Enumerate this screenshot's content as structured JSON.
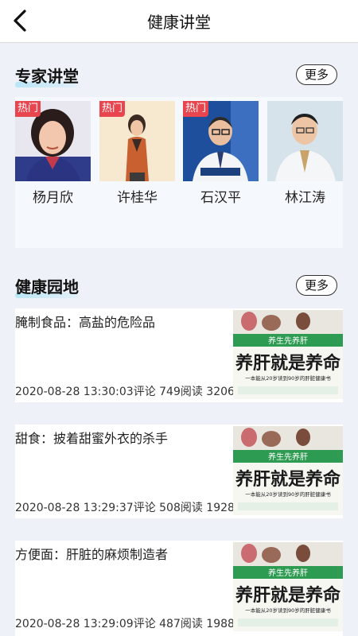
{
  "header": {
    "title": "健康讲堂",
    "back_icon": "chevron-left-icon"
  },
  "experts_section": {
    "title": "专家讲堂",
    "more_label": "更多",
    "experts": [
      {
        "name": "杨月欣",
        "tag": "热门"
      },
      {
        "name": "许桂华",
        "tag": "热门"
      },
      {
        "name": "石汉平",
        "tag": "热门"
      },
      {
        "name": "林江涛",
        "tag": ""
      }
    ]
  },
  "garden_section": {
    "title": "健康园地",
    "more_label": "更多",
    "thumb_banner": "养生先养肝",
    "thumb_headline": "养肝就是养命",
    "thumb_caption": "一本能从20岁读到90岁的肝脏健康书",
    "articles": [
      {
        "title": "腌制食品：高盐的危险品",
        "meta": "2020-08-28 13:30:03评论 749阅读 3206"
      },
      {
        "title": "甜食：披着甜蜜外衣的杀手",
        "meta": "2020-08-28 13:29:37评论 508阅读 1928"
      },
      {
        "title": "方便面：肝脏的麻烦制造者",
        "meta": "2020-08-28 13:29:09评论 487阅读 1988"
      }
    ]
  },
  "colors": {
    "accent_tag": "#e8454f",
    "thumb_green": "#2e9b52"
  }
}
